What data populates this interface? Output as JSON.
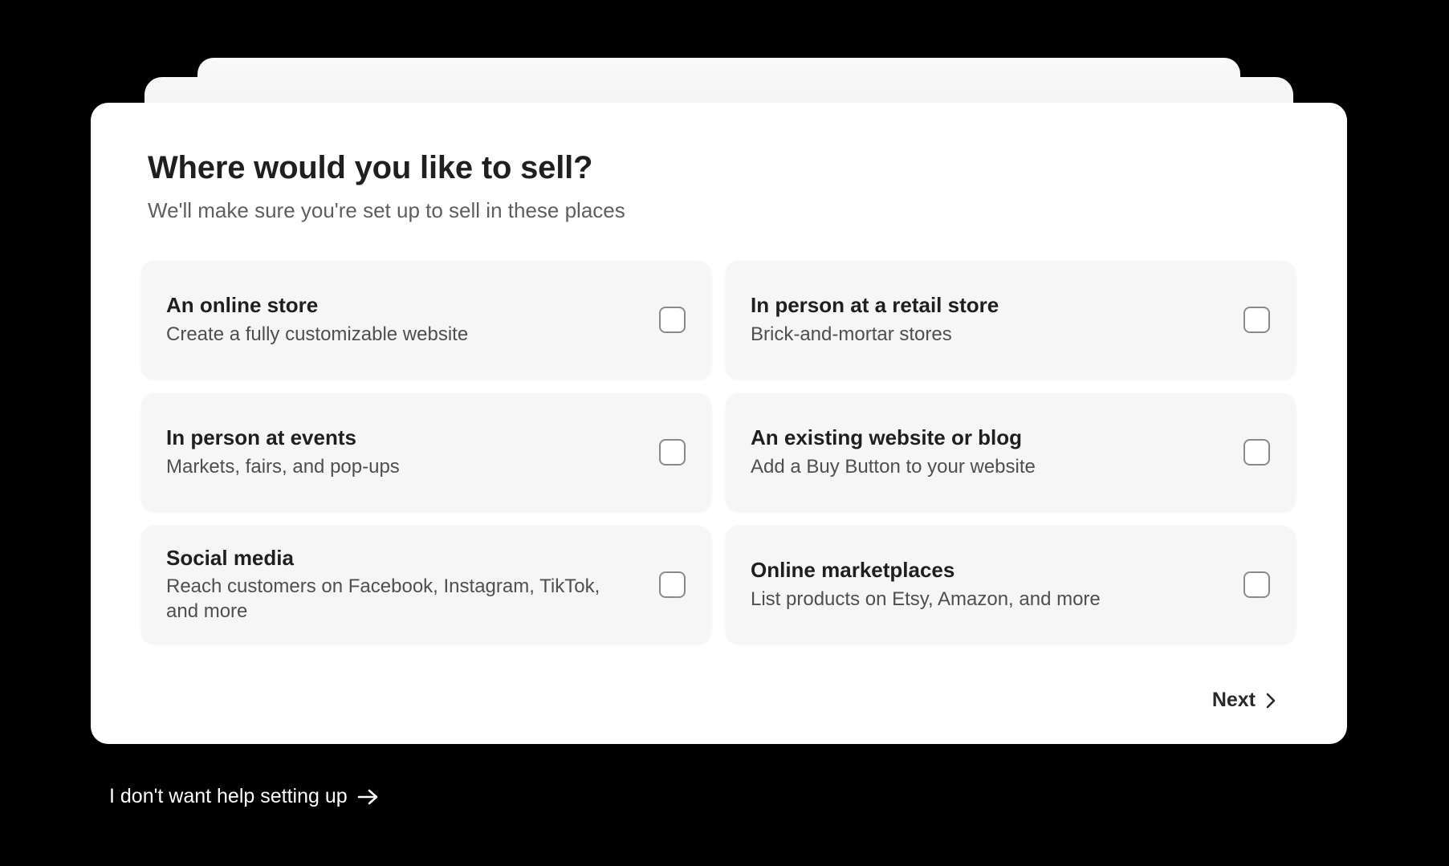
{
  "dialog": {
    "title": "Where would you like to sell?",
    "subtitle": "We'll make sure you're set up to sell in these places",
    "next_label": "Next"
  },
  "options": [
    {
      "title": "An online store",
      "description": "Create a fully customizable website",
      "checked": false
    },
    {
      "title": "In person at a retail store",
      "description": "Brick-and-mortar stores",
      "checked": false
    },
    {
      "title": "In person at events",
      "description": "Markets, fairs, and pop-ups",
      "checked": false
    },
    {
      "title": "An existing website or blog",
      "description": "Add a Buy Button to your website",
      "checked": false
    },
    {
      "title": "Social media",
      "description": "Reach customers on Facebook, Instagram, TikTok, and more",
      "checked": false
    },
    {
      "title": "Online marketplaces",
      "description": "List products on Etsy, Amazon, and more",
      "checked": false
    }
  ],
  "footer": {
    "skip_label": "I don't want help setting up"
  },
  "icons": {
    "next": "chevron-right-icon",
    "skip": "arrow-right-icon"
  },
  "colors": {
    "background": "#000000",
    "card": "#ffffff",
    "option_background": "#f6f6f6",
    "text_primary": "#1f1f1f",
    "text_secondary": "#5e5e5e"
  }
}
